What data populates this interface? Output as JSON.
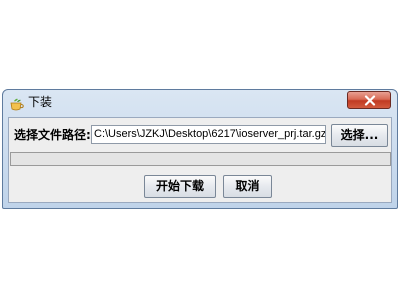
{
  "window": {
    "title": "下装",
    "close_label": "x"
  },
  "form": {
    "path_label": "选择文件路径:",
    "path_value": "C:\\Users\\JZKJ\\Desktop\\6217\\ioserver_prj.tar.gz",
    "select_button": "选择..."
  },
  "progress": {
    "fraction": 0
  },
  "buttons": {
    "start": "开始下载",
    "cancel": "取消"
  },
  "colors": {
    "close_button": "#c13a22",
    "title_bar": "#dae6f3",
    "client_background": "#eeeeee"
  },
  "icons": {
    "app_icon": "java-cup-icon",
    "close_icon": "close-x-icon"
  }
}
